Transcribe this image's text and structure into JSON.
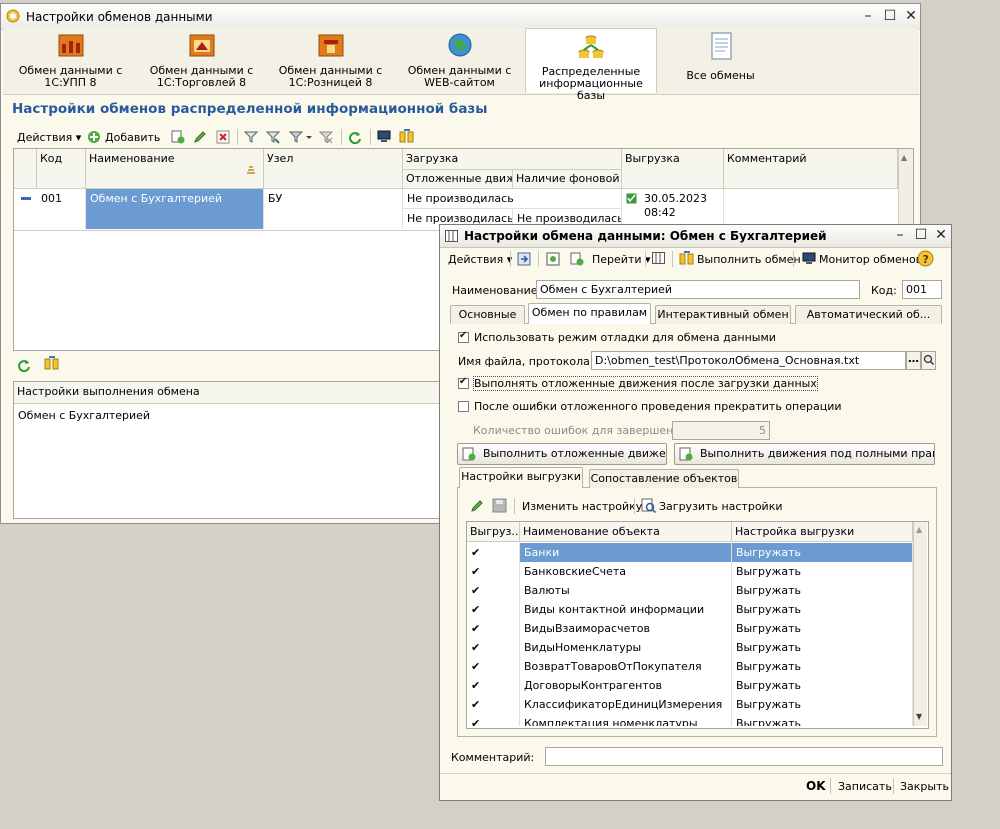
{
  "main": {
    "title": "Настройки обменов данными",
    "tabs": [
      {
        "label": "Обмен данными с 1С:УПП 8",
        "icon": "factory-icon"
      },
      {
        "label": "Обмен данными с 1С:Торговлей 8",
        "icon": "trade-icon"
      },
      {
        "label": "Обмен данными с 1С:Розницей 8",
        "icon": "retail-icon"
      },
      {
        "label": "Обмен данными с WEB-сайтом",
        "icon": "globe-icon"
      },
      {
        "label": "Распределенные информационные базы",
        "icon": "distributed-db-icon"
      },
      {
        "label": "Все обмены",
        "icon": "document-icon"
      }
    ],
    "heading": "Настройки обменов распределенной информационной базы",
    "toolbar": {
      "actions": "Действия",
      "add": "Добавить"
    },
    "grid": {
      "columns": {
        "code": "Код",
        "name": "Наименование",
        "node": "Узел",
        "load": "Загрузка",
        "load_deferred": "Отложенные движ...",
        "load_background": "Наличие фоновой ...",
        "unload": "Выгрузка",
        "comment": "Комментарий"
      },
      "row": {
        "code": "001",
        "name": "Обмен с Бухгалтерией",
        "node": "БУ",
        "load1": "Не производилась",
        "load2": "Не производилась",
        "load3": "Не производилась",
        "unload_date": "30.05.2023",
        "unload_time": "08:42"
      }
    },
    "exec_settings": {
      "header": "Настройки выполнения обмена",
      "value": "Обмен с Бухгалтерией"
    }
  },
  "dialog": {
    "title": "Настройки обмена данными: Обмен с Бухгалтерией",
    "toolbar": {
      "actions": "Действия",
      "goto": "Перейти",
      "execute": "Выполнить обмен",
      "monitor": "Монитор обменов"
    },
    "name_label": "Наименование:",
    "name_value": "Обмен с Бухгалтерией",
    "code_label": "Код:",
    "code_value": "001",
    "tabs": [
      "Основные",
      "Обмен по правилам",
      "Интерактивный обмен",
      "Автоматический об..."
    ],
    "debug_mode": {
      "label": "Использовать режим отладки для обмена данными",
      "checked": true
    },
    "log_file_label": "Имя файла, протокола:",
    "log_file_value": "D:\\obmen_test\\ПротоколОбмена_Основная.txt",
    "deferred_after_load": {
      "label": "Выполнять отложенные движения после загрузки данных",
      "checked": true
    },
    "stop_on_error": {
      "label": "После ошибки отложенного проведения прекратить операции",
      "checked": false
    },
    "error_count_label": "Количество ошибок для завершения:",
    "error_count_value": "5",
    "btn_deferred": "Выполнить отложенные движения...",
    "btn_full_rights": "Выполнить движения под полными правами...",
    "subtabs": [
      "Настройки выгрузки",
      "Сопоставление объектов"
    ],
    "subtoolbar": {
      "change": "Изменить настройку",
      "load": "Загрузить настройки"
    },
    "table": {
      "columns": [
        "Выгруз...",
        "Наименование объекта",
        "Настройка выгрузки"
      ],
      "rows": [
        {
          "name": "Банки",
          "setting": "Выгружать"
        },
        {
          "name": "БанковскиеСчета",
          "setting": "Выгружать"
        },
        {
          "name": "Валюты",
          "setting": "Выгружать"
        },
        {
          "name": "Виды контактной информации",
          "setting": "Выгружать"
        },
        {
          "name": "ВидыВзаиморасчетов",
          "setting": "Выгружать"
        },
        {
          "name": "ВидыНоменклатуры",
          "setting": "Выгружать"
        },
        {
          "name": "ВозвратТоваровОтПокупателя",
          "setting": "Выгружать"
        },
        {
          "name": "ДоговорыКонтрагентов",
          "setting": "Выгружать"
        },
        {
          "name": "КлассификаторЕдиницИзмерения",
          "setting": "Выгружать"
        },
        {
          "name": "Комплектация номенклатуры",
          "setting": "Выгружать"
        }
      ]
    },
    "comment_label": "Комментарий:",
    "footer": {
      "ok": "OK",
      "save": "Записать",
      "close": "Закрыть"
    }
  },
  "colors": {
    "accent": "#2a5a9e",
    "selection": "#6b9bd2",
    "window_bg": "#fbf9ec"
  }
}
